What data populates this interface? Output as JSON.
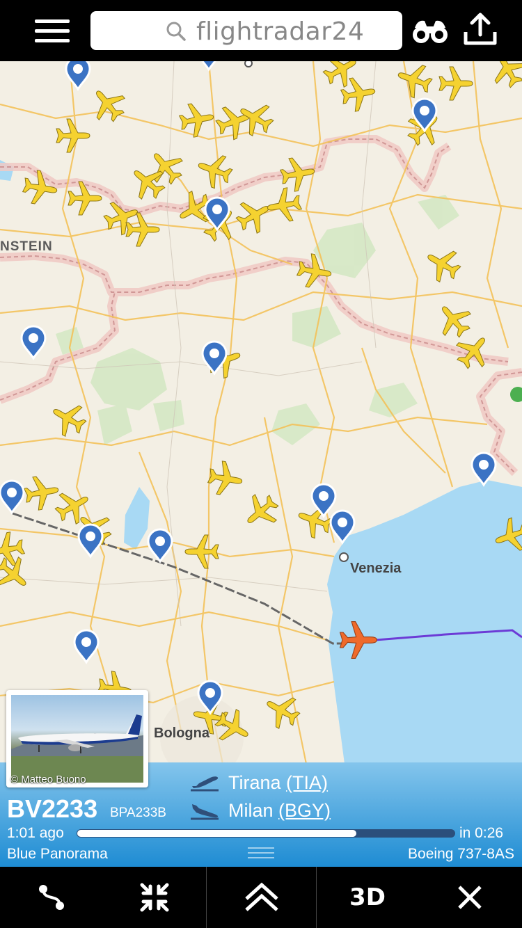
{
  "search": {
    "placeholder": "flightradar24"
  },
  "map": {
    "region_label": "NSTEIN",
    "cities": [
      {
        "name": "Venezia"
      },
      {
        "name": "Bologna"
      }
    ]
  },
  "flight": {
    "number": "BV2233",
    "registration": "BPA233B",
    "origin_city": "Tirana",
    "origin_code": "(TIA)",
    "destination_city": "Milan",
    "destination_code": "(BGY)",
    "elapsed": "1:01 ago",
    "remaining": "in 0:26",
    "progress": 0.74,
    "airline": "Blue Panorama",
    "aircraft": "Boeing 737-8AS",
    "photo_credit": "© Matteo Buono"
  },
  "toolbar": {
    "three_d_label": "3D"
  },
  "colors": {
    "selected_plane": "#ef6a2b",
    "plane": "#f5d230",
    "route_flown": "#6c3bd6",
    "route_planned": "#666666",
    "sea": "#a8d9f4",
    "pin": "#3b73c4"
  }
}
